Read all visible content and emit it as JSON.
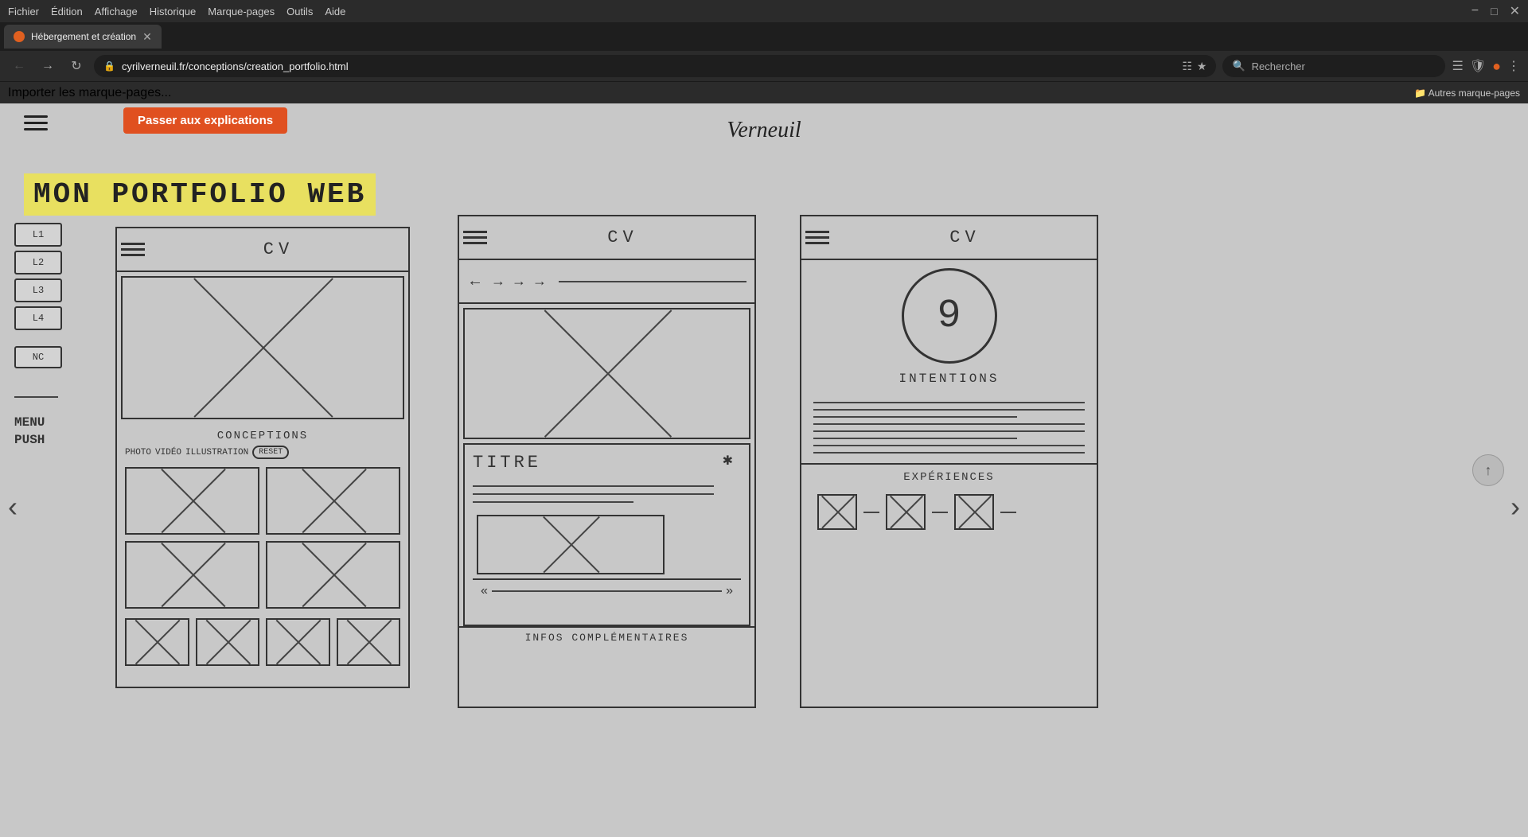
{
  "browser": {
    "menu_items": [
      "Fichier",
      "Édition",
      "Affichage",
      "Historique",
      "Marque-pages",
      "Outils",
      "Aide"
    ],
    "tab": {
      "title": "Hébergement et création",
      "favicon_color": "#e06020"
    },
    "address": "cyrilverneuil.fr/conceptions/creation_portfolio.html",
    "search_placeholder": "Rechercher",
    "bookmark_item": "Importer les marque-pages...",
    "bookmark_other": "Autres marque-pages"
  },
  "page": {
    "orange_button": "Passer aux explications",
    "logo": "Verneuil",
    "title": "MON PORTFOLIO WEB",
    "sidebar_items": [
      "L1",
      "L2",
      "L3",
      "L4"
    ],
    "sidebar_nc": "NC",
    "sidebar_menu_label": "MENU\nPUSH",
    "sketch1": {
      "header_text": "CV",
      "filters_title": "CONCEPTIONS",
      "filter_labels": [
        "PHOTO",
        "VIDÉO",
        "ILLUSTRATION"
      ],
      "reset_label": "RESET"
    },
    "sketch2": {
      "header_text": "CV",
      "titre": "TITRE",
      "footer_label": "INFOS COMPLÉMENTAIRES"
    },
    "sketch3": {
      "header_text": "CV",
      "circle_text": "9",
      "intentions_label": "INTENTIONS",
      "experiences_label": "EXPÉRIENCES"
    }
  }
}
